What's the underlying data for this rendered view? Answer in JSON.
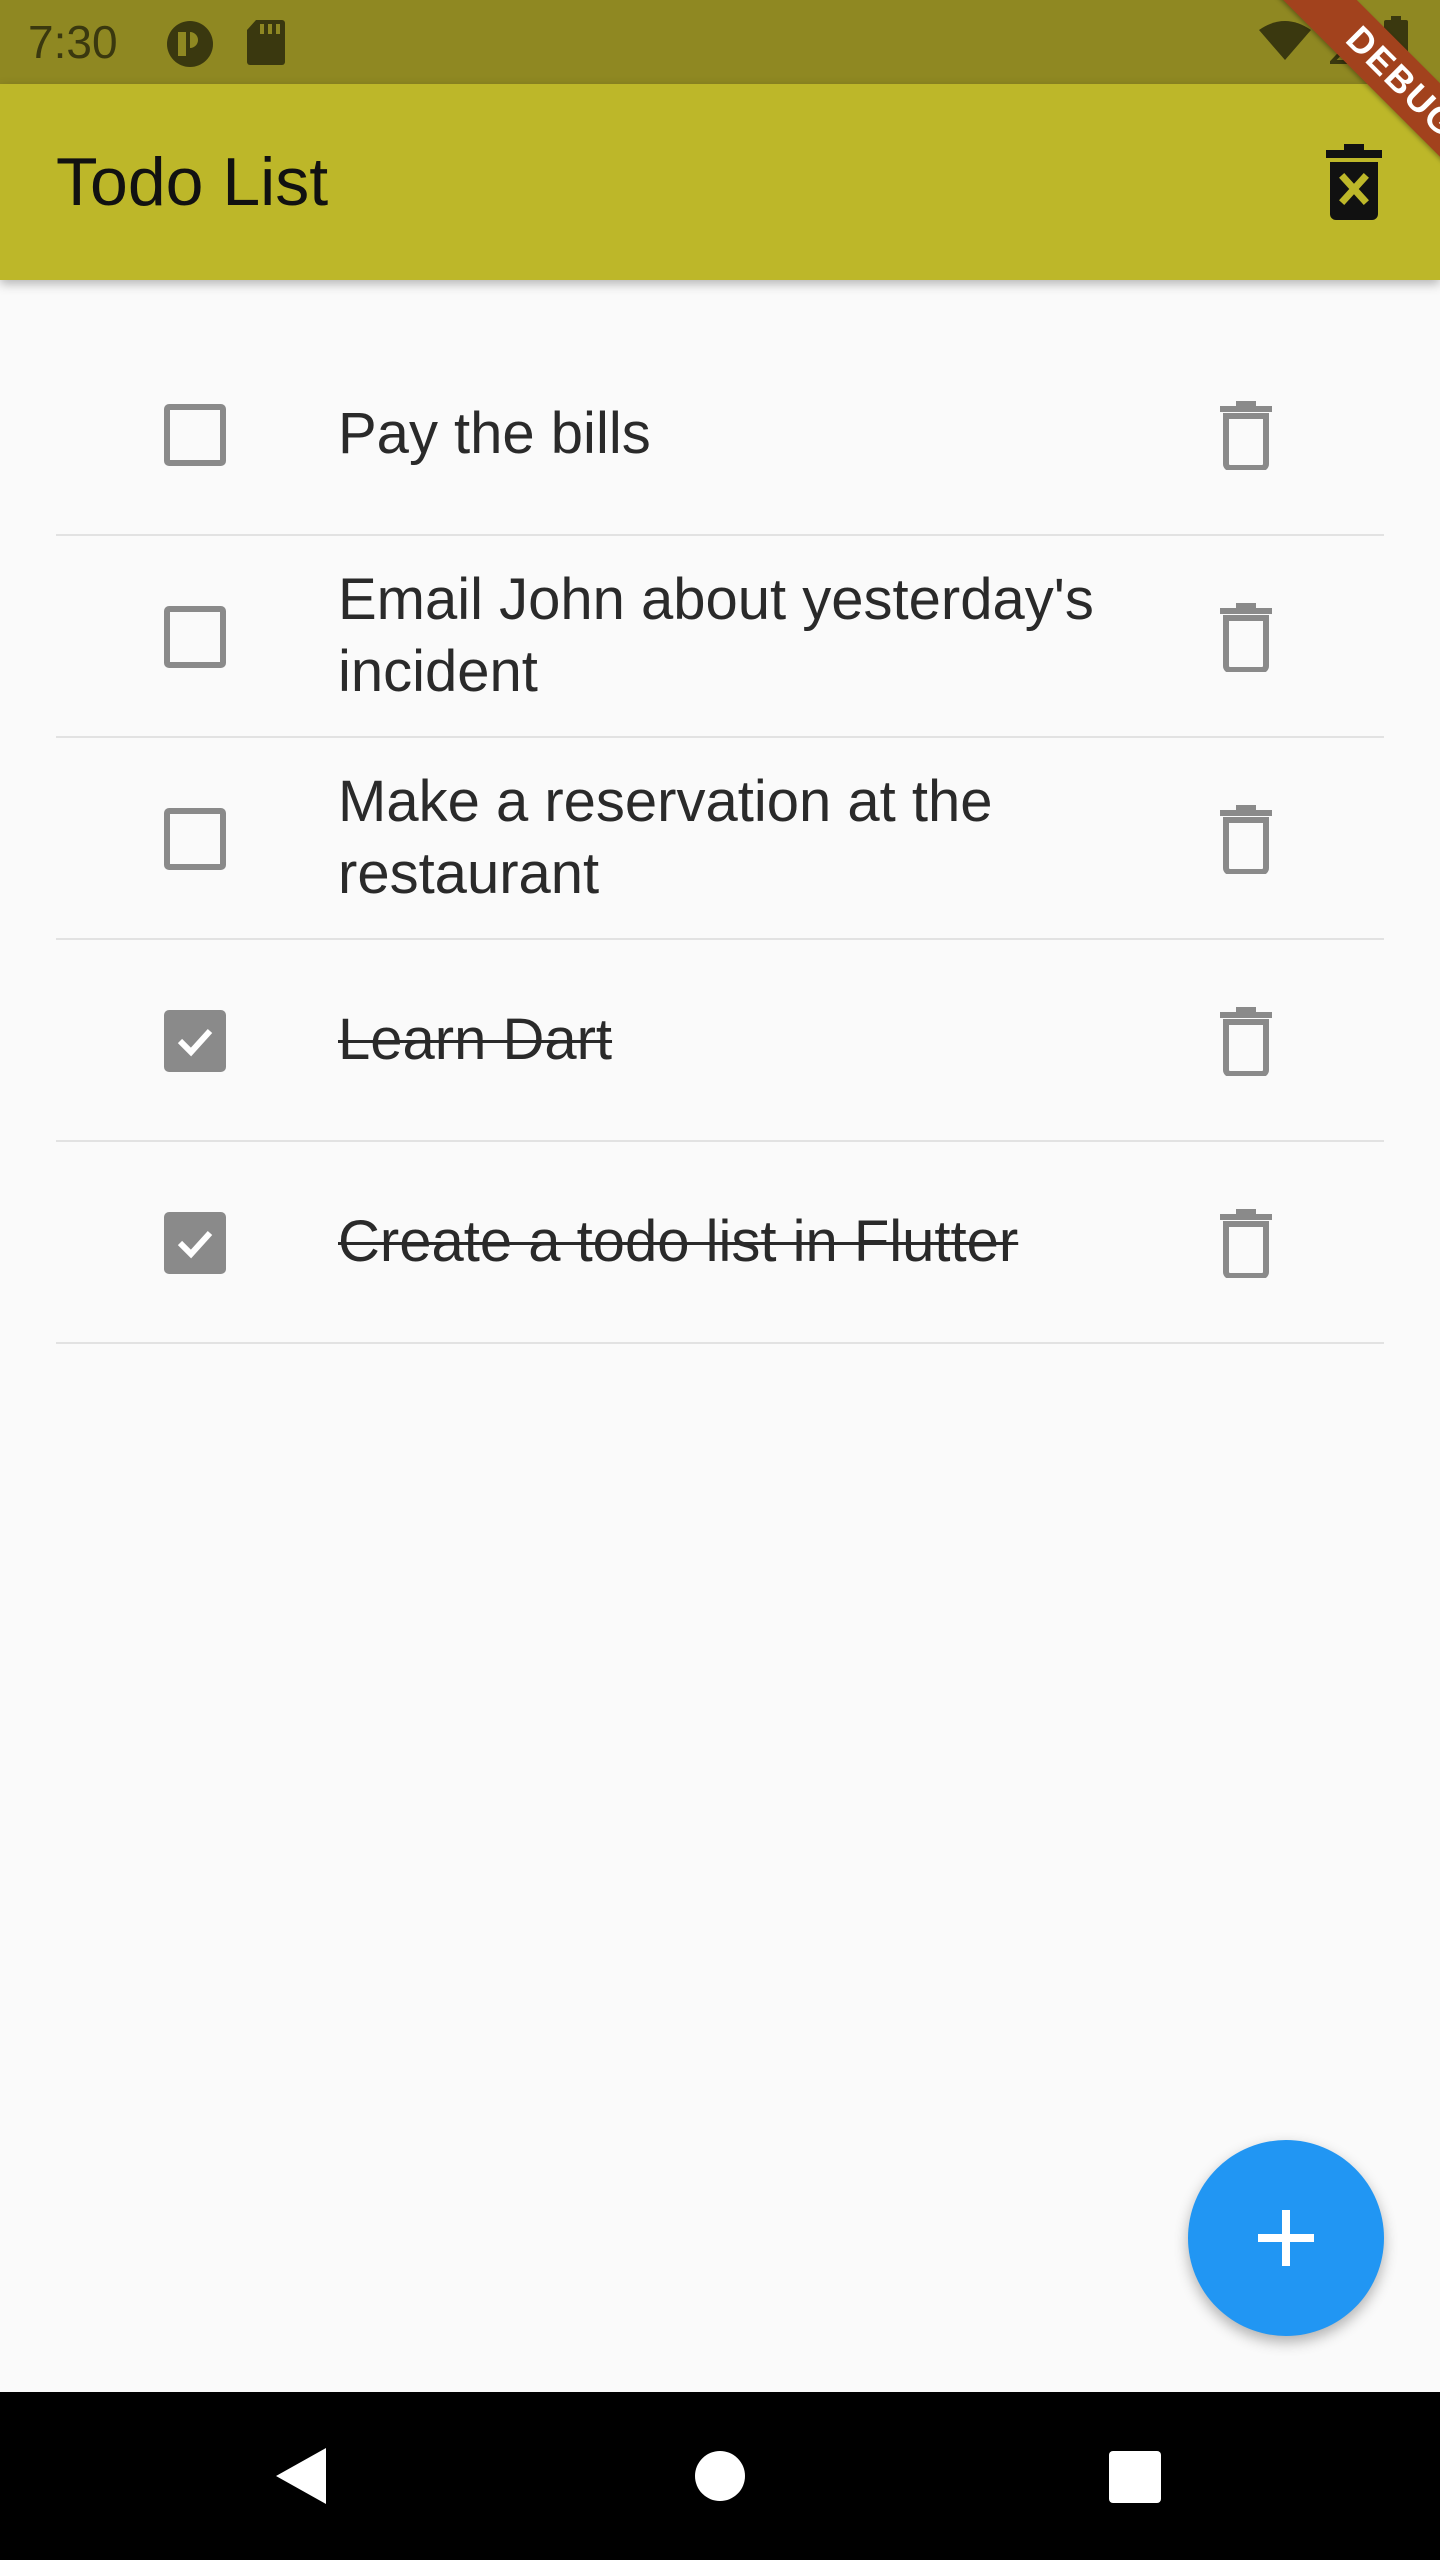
{
  "status_bar": {
    "time": "7:30",
    "icons": [
      "data-saver-icon",
      "sd-card-icon",
      "wifi-icon",
      "cell-signal-icon",
      "battery-icon"
    ]
  },
  "debug_banner": {
    "label": "DEBUG"
  },
  "app_bar": {
    "title": "Todo List",
    "action_icon": "delete-forever-icon",
    "background": "#bdb729"
  },
  "todos": [
    {
      "text": "Pay the bills",
      "checked": false
    },
    {
      "text": "Email John about yesterday's incident",
      "checked": false
    },
    {
      "text": "Make a reservation at the restaurant",
      "checked": false
    },
    {
      "text": "Learn Dart",
      "checked": true
    },
    {
      "text": "Create a todo list in Flutter",
      "checked": true
    }
  ],
  "fab": {
    "icon": "plus-icon",
    "color": "#2196f3"
  },
  "nav_bar": {
    "buttons": [
      "back-icon",
      "home-icon",
      "recents-icon"
    ]
  }
}
